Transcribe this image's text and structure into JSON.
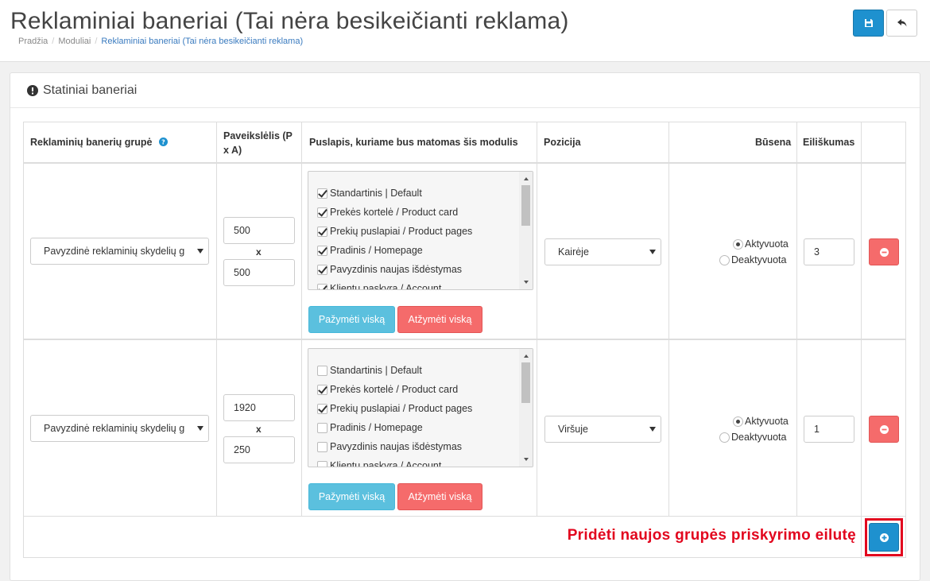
{
  "header": {
    "title": "Reklaminiai baneriai (Tai nėra besikeičianti reklama)",
    "breadcrumb": [
      "Pradžia",
      "Moduliai",
      "Reklaminiai baneriai (Tai nėra besikeičianti reklama)"
    ],
    "save_icon": "floppy-disk-icon",
    "back_icon": "reply-arrow-icon"
  },
  "panel": {
    "title": "Statiniai baneriai",
    "icon": "exclamation-circle-icon"
  },
  "table": {
    "headers": {
      "group": "Reklaminių banerių grupė",
      "image": "Paveikslėlis (P x A)",
      "page": "Puslapis, kuriame bus matomas šis modulis",
      "position": "Pozicija",
      "status": "Būsena",
      "order": "Eiliškumas"
    },
    "group_help_icon": "question-circle-icon",
    "times_sign": "x",
    "rows": [
      {
        "group": "Pavyzdinė reklaminių skydelių g",
        "width": "500",
        "height": "500",
        "pages": [
          {
            "label": "Standartinis | Default",
            "checked": true
          },
          {
            "label": "Prekės kortelė / Product card",
            "checked": true
          },
          {
            "label": "Prekių puslapiai / Product pages",
            "checked": true
          },
          {
            "label": "Pradinis / Homepage",
            "checked": true
          },
          {
            "label": "Pavyzdinis naujas išdėstymas",
            "checked": true
          },
          {
            "label": "Klientų paskyra / Account",
            "checked": true
          }
        ],
        "select_all": "Pažymėti viską",
        "unselect_all": "Atžymėti viską",
        "position": "Kairėje",
        "status_options": [
          "Aktyvuota",
          "Deaktyvuota"
        ],
        "status_selected": "Aktyvuota",
        "order": "3"
      },
      {
        "group": "Pavyzdinė reklaminių skydelių g",
        "width": "1920",
        "height": "250",
        "pages": [
          {
            "label": "Standartinis | Default",
            "checked": false
          },
          {
            "label": "Prekės kortelė / Product card",
            "checked": true
          },
          {
            "label": "Prekių puslapiai / Product pages",
            "checked": true
          },
          {
            "label": "Pradinis / Homepage",
            "checked": false
          },
          {
            "label": "Pavyzdinis naujas išdėstymas",
            "checked": false
          },
          {
            "label": "Klientų paskyra / Account",
            "checked": false
          }
        ],
        "select_all": "Pažymėti viską",
        "unselect_all": "Atžymėti viską",
        "position": "Viršuje",
        "status_options": [
          "Aktyvuota",
          "Deaktyvuota"
        ],
        "status_selected": "Aktyvuota",
        "order": "1"
      }
    ],
    "remove_icon": "minus-circle-icon"
  },
  "footer": {
    "add_label": "Pridėti naujos grupės priskyrimo eilutę",
    "add_icon": "plus-circle-icon",
    "highlight_color": "#e2061e"
  },
  "colors": {
    "primary": "#1e91cf",
    "info": "#5bc0de",
    "danger": "#f56b6b"
  }
}
